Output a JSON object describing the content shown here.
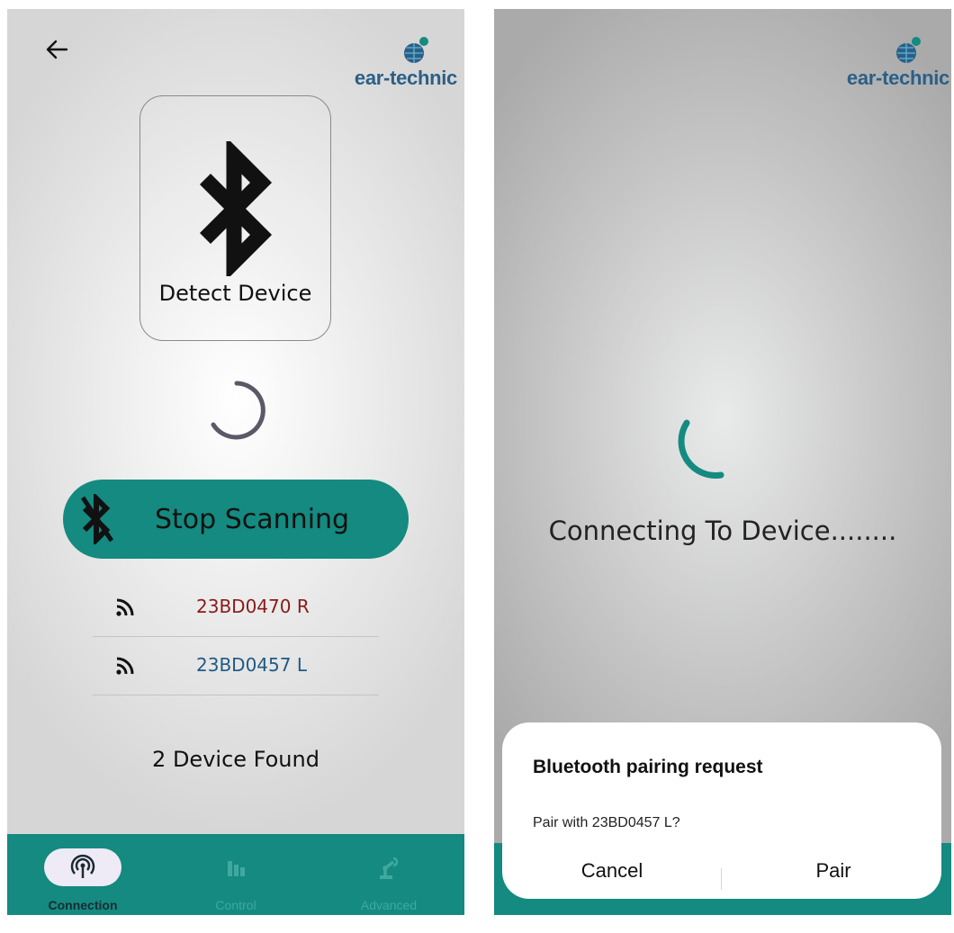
{
  "left_screen": {
    "logo_text": "ear-technic",
    "detect_card": {
      "label": "Detect Device",
      "icon": "bluetooth-icon"
    },
    "stop_button": {
      "label": "Stop Scanning",
      "icon": "bluetooth-disabled-icon"
    },
    "devices": [
      {
        "name": "23BD0470 R",
        "color": "#8b1a1a",
        "icon": "signal-icon"
      },
      {
        "name": "23BD0457 L",
        "color": "#1f5a85",
        "icon": "signal-icon"
      }
    ],
    "found_text": "2 Device Found",
    "nav": [
      {
        "label": "Connection",
        "icon": "antenna-icon",
        "active": true
      },
      {
        "label": "Control",
        "icon": "equalizer-icon",
        "active": false
      },
      {
        "label": "Advanced",
        "icon": "robot-arm-icon",
        "active": false
      }
    ]
  },
  "right_screen": {
    "logo_text": "ear-technic",
    "status_text": "Connecting To Device........",
    "dialog": {
      "title": "Bluetooth pairing request",
      "message": "Pair with 23BD0457 L?",
      "cancel_label": "Cancel",
      "pair_label": "Pair"
    }
  },
  "colors": {
    "accent": "#148a80",
    "logo": "#2b5f87",
    "device_right": "#8b1a1a",
    "device_left": "#1f5a85"
  }
}
